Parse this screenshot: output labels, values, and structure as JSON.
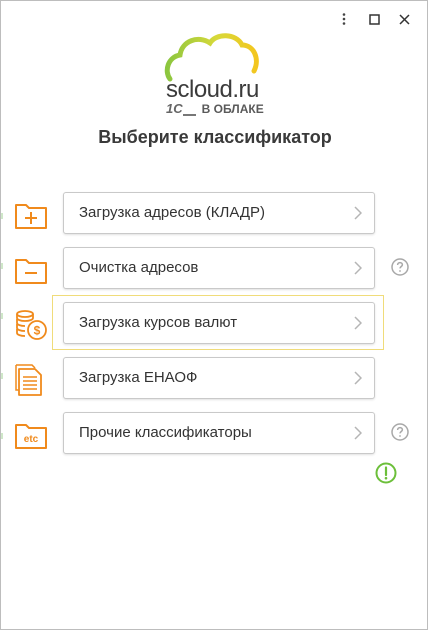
{
  "logo": {
    "brand": "scloud.ru",
    "subtitle_mark": "1С",
    "subtitle": "В ОБЛАКЕ"
  },
  "page": {
    "title": "Выберите классификатор"
  },
  "window_controls": [
    "more-vertical-icon",
    "maximize-icon",
    "close-icon"
  ],
  "items": [
    {
      "label": "Загрузка адресов (КЛАДР)",
      "icon": "folder-plus-icon",
      "help": false
    },
    {
      "label": "Очистка адресов",
      "icon": "folder-minus-icon",
      "help": true
    },
    {
      "label": "Загрузка курсов валют",
      "icon": "coins-icon",
      "help": false,
      "highlighted": true
    },
    {
      "label": "Загрузка ЕНАОФ",
      "icon": "document-icon",
      "help": false
    },
    {
      "label": "Прочие классификаторы",
      "icon": "folder-etc-icon",
      "folder_text": "etc",
      "help": true
    }
  ],
  "colors": {
    "accent_orange": "#f08a1c",
    "help_grey": "#a8a8a8",
    "alert_green": "#6cbf3a",
    "highlight_yellow": "#f0dc7a"
  }
}
